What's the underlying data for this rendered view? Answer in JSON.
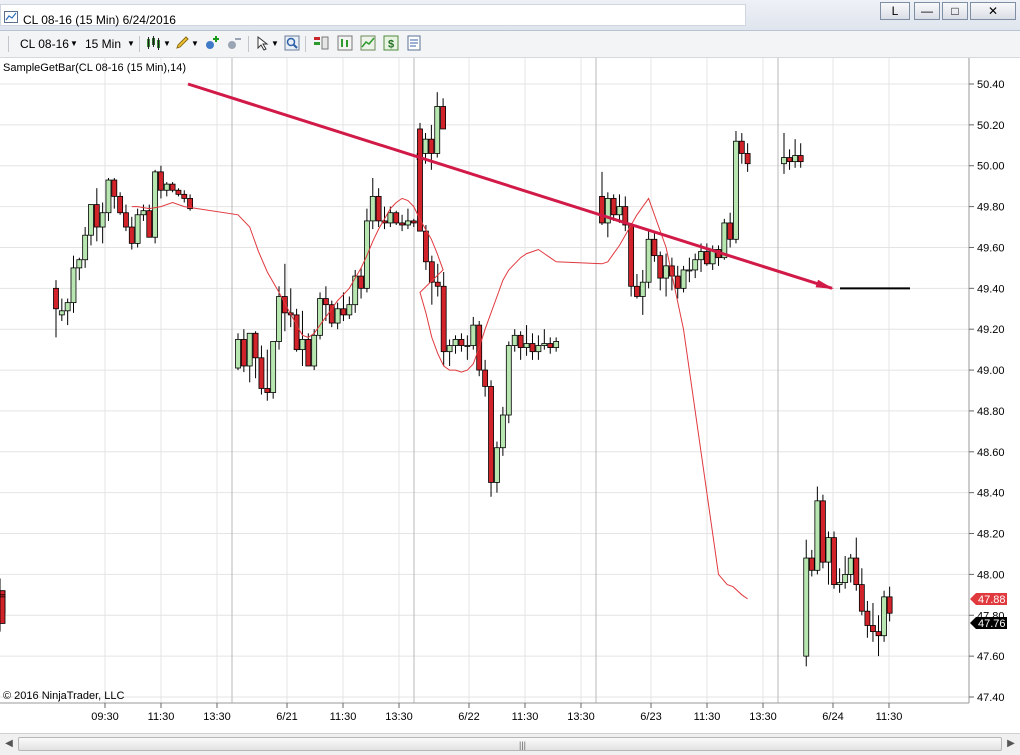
{
  "window": {
    "title": "CL 08-16 (15 Min)  6/24/2016",
    "layout_button": "L",
    "minimize_label": "—",
    "maximize_label": "□",
    "close_label": "✕"
  },
  "toolbar": {
    "instrument": "CL 08-16",
    "interval": "15 Min"
  },
  "chart": {
    "indicator_label": "SampleGetBar(CL 08-16 (15 Min),14)",
    "copyright": "© 2016 NinjaTrader, LLC",
    "last_price_label": "47.76",
    "indicator_price_label": "47.88",
    "colors": {
      "up": "#b8e6b0",
      "down": "#d2232a",
      "wick": "#000000",
      "sma": "#e0393e",
      "arrow": "#d11a47",
      "grid": "#e4e4e4",
      "session": "#b8b8b8"
    }
  },
  "chart_data": {
    "type": "candlestick",
    "title": "",
    "ylim": [
      47.4,
      50.5
    ],
    "y_ticks": [
      "50.40",
      "50.20",
      "50.00",
      "49.80",
      "49.60",
      "49.40",
      "49.20",
      "49.00",
      "48.80",
      "48.60",
      "48.40",
      "48.20",
      "48.00",
      "47.80",
      "47.60",
      "47.40"
    ],
    "x_ticks": [
      "09:30",
      "11:30",
      "13:30",
      "6/21",
      "11:30",
      "13:30",
      "6/22",
      "11:30",
      "13:30",
      "6/23",
      "11:30",
      "13:30",
      "6/24",
      "11:30"
    ],
    "session_separators": [
      "6/20",
      "6/21",
      "6/22",
      "6/23",
      "6/24"
    ],
    "candles": [
      [
        49.4,
        49.44,
        49.16,
        49.3
      ],
      [
        49.27,
        49.35,
        49.24,
        49.29
      ],
      [
        49.29,
        49.35,
        49.22,
        49.33
      ],
      [
        49.33,
        49.56,
        49.28,
        49.5
      ],
      [
        49.5,
        49.55,
        49.44,
        49.54
      ],
      [
        49.54,
        49.7,
        49.5,
        49.66
      ],
      [
        49.66,
        49.81,
        49.61,
        49.81
      ],
      [
        49.81,
        49.89,
        49.63,
        49.7
      ],
      [
        49.7,
        49.82,
        49.62,
        49.77
      ],
      [
        49.77,
        49.94,
        49.73,
        49.93
      ],
      [
        49.93,
        49.94,
        49.79,
        49.85
      ],
      [
        49.85,
        49.87,
        49.76,
        49.77
      ],
      [
        49.77,
        49.81,
        49.68,
        49.7
      ],
      [
        49.7,
        49.75,
        49.59,
        49.62
      ],
      [
        49.62,
        49.79,
        49.6,
        49.76
      ],
      [
        49.76,
        49.81,
        49.73,
        49.78
      ],
      [
        49.78,
        49.81,
        49.65,
        49.65
      ],
      [
        49.65,
        49.98,
        49.62,
        49.97
      ],
      [
        49.97,
        50.0,
        49.84,
        49.88
      ],
      [
        49.88,
        49.92,
        49.85,
        49.91
      ],
      [
        49.91,
        49.92,
        49.87,
        49.88
      ],
      [
        49.88,
        49.89,
        49.85,
        49.86
      ],
      [
        49.86,
        49.88,
        49.82,
        49.84
      ],
      [
        49.84,
        49.86,
        49.78,
        49.79
      ],
      [
        49.01,
        49.18,
        49.0,
        49.15
      ],
      [
        49.15,
        49.2,
        48.99,
        49.02
      ],
      [
        49.02,
        49.15,
        48.94,
        49.18
      ],
      [
        49.18,
        49.19,
        48.96,
        49.06
      ],
      [
        49.06,
        49.12,
        48.88,
        48.91
      ],
      [
        48.91,
        49.1,
        48.85,
        48.89
      ],
      [
        48.89,
        49.14,
        48.86,
        49.14
      ],
      [
        49.14,
        49.41,
        49.1,
        49.36
      ],
      [
        49.36,
        49.52,
        49.19,
        49.28
      ],
      [
        49.28,
        49.4,
        49.21,
        49.27
      ],
      [
        49.27,
        49.3,
        49.09,
        49.1
      ],
      [
        49.1,
        49.29,
        49.02,
        49.15
      ],
      [
        49.15,
        49.18,
        49.03,
        49.02
      ],
      [
        49.02,
        49.2,
        49.0,
        49.17
      ],
      [
        49.17,
        49.38,
        49.15,
        49.35
      ],
      [
        49.35,
        49.41,
        49.24,
        49.32
      ],
      [
        49.32,
        49.34,
        49.21,
        49.23
      ],
      [
        49.23,
        49.33,
        49.2,
        49.3
      ],
      [
        49.3,
        49.38,
        49.24,
        49.27
      ],
      [
        49.27,
        49.36,
        49.25,
        49.32
      ],
      [
        49.32,
        49.49,
        49.28,
        49.46
      ],
      [
        49.46,
        49.5,
        49.35,
        49.4
      ],
      [
        49.4,
        49.79,
        49.38,
        49.73
      ],
      [
        49.73,
        49.94,
        49.69,
        49.85
      ],
      [
        49.85,
        49.89,
        49.7,
        49.73
      ],
      [
        49.73,
        49.8,
        49.69,
        49.72
      ],
      [
        49.72,
        49.8,
        49.7,
        49.77
      ],
      [
        49.77,
        49.78,
        49.71,
        49.72
      ],
      [
        49.72,
        49.76,
        49.68,
        49.71
      ],
      [
        49.71,
        49.79,
        49.69,
        49.73
      ],
      [
        49.73,
        49.74,
        49.7,
        49.72
      ],
      [
        50.03,
        50.12,
        49.97,
        50.06
      ],
      [
        50.06,
        50.16,
        50.01,
        50.13
      ],
      [
        50.13,
        50.2,
        49.98,
        50.06
      ],
      [
        50.06,
        50.36,
        50.04,
        50.29
      ],
      [
        50.29,
        50.33,
        50.18,
        50.18
      ],
      [
        50.18,
        50.21,
        49.68,
        49.68
      ],
      [
        49.68,
        49.71,
        49.49,
        49.53
      ],
      [
        49.53,
        49.56,
        49.32,
        49.43
      ],
      [
        49.43,
        49.52,
        49.36,
        49.41
      ],
      [
        49.41,
        49.48,
        49.02,
        49.09
      ],
      [
        49.09,
        49.15,
        49.02,
        49.12
      ],
      [
        49.12,
        49.17,
        49.08,
        49.15
      ],
      [
        49.15,
        49.18,
        49.09,
        49.12
      ],
      [
        49.12,
        49.17,
        49.05,
        49.12
      ],
      [
        49.12,
        49.26,
        49.1,
        49.22
      ],
      [
        49.22,
        49.24,
        48.97,
        49.0
      ],
      [
        49.0,
        49.05,
        48.87,
        48.92
      ],
      [
        48.92,
        48.95,
        48.38,
        48.45
      ],
      [
        48.45,
        48.65,
        48.4,
        48.62
      ],
      [
        48.62,
        48.82,
        48.58,
        48.78
      ],
      [
        48.78,
        49.14,
        48.74,
        49.12
      ],
      [
        49.12,
        49.2,
        49.09,
        49.17
      ],
      [
        49.17,
        49.19,
        49.05,
        49.11
      ],
      [
        49.11,
        49.22,
        49.07,
        49.13
      ],
      [
        49.13,
        49.18,
        49.05,
        49.09
      ],
      [
        49.09,
        49.17,
        49.05,
        49.12
      ],
      [
        49.12,
        49.2,
        49.1,
        49.13
      ],
      [
        49.13,
        49.16,
        49.08,
        49.11
      ],
      [
        49.11,
        49.16,
        49.09,
        49.14
      ],
      [
        49.85,
        49.97,
        49.71,
        49.72
      ],
      [
        49.72,
        49.87,
        49.65,
        49.84
      ],
      [
        49.84,
        49.86,
        49.73,
        49.76
      ],
      [
        49.76,
        49.86,
        49.72,
        49.8
      ],
      [
        49.8,
        49.85,
        49.68,
        49.71
      ],
      [
        49.71,
        49.72,
        49.36,
        49.41
      ],
      [
        49.41,
        49.47,
        49.35,
        49.36
      ],
      [
        49.36,
        49.49,
        49.27,
        49.43
      ],
      [
        49.43,
        49.69,
        49.4,
        49.64
      ],
      [
        49.64,
        49.67,
        49.53,
        49.56
      ],
      [
        49.56,
        49.58,
        49.39,
        49.45
      ],
      [
        49.45,
        49.57,
        49.36,
        49.51
      ],
      [
        49.51,
        49.55,
        49.39,
        49.46
      ],
      [
        49.46,
        49.51,
        49.35,
        49.4
      ],
      [
        49.4,
        49.51,
        49.38,
        49.49
      ],
      [
        49.49,
        49.55,
        49.43,
        49.49
      ],
      [
        49.49,
        49.57,
        49.45,
        49.54
      ],
      [
        49.54,
        49.62,
        49.48,
        49.58
      ],
      [
        49.58,
        49.62,
        49.51,
        49.52
      ],
      [
        49.52,
        49.61,
        49.49,
        49.59
      ],
      [
        49.59,
        49.61,
        49.51,
        49.55
      ],
      [
        49.55,
        49.74,
        49.54,
        49.72
      ],
      [
        49.72,
        49.77,
        49.6,
        49.64
      ],
      [
        49.64,
        50.17,
        49.62,
        50.12
      ],
      [
        50.12,
        50.16,
        50.01,
        50.06
      ],
      [
        50.06,
        50.11,
        49.97,
        50.01
      ],
      [
        50.01,
        50.16,
        49.96,
        50.04
      ],
      [
        50.04,
        50.08,
        49.98,
        50.02
      ],
      [
        50.02,
        50.13,
        49.99,
        50.05
      ],
      [
        50.05,
        50.11,
        49.99,
        50.02
      ],
      [
        47.6,
        48.17,
        47.55,
        48.08
      ],
      [
        48.08,
        48.12,
        47.99,
        48.02
      ],
      [
        48.02,
        48.43,
        48.0,
        48.36
      ],
      [
        48.36,
        48.39,
        48.03,
        48.06
      ],
      [
        48.06,
        48.21,
        47.95,
        48.18
      ],
      [
        48.18,
        48.21,
        47.93,
        47.95
      ],
      [
        47.95,
        48.03,
        47.91,
        47.96
      ],
      [
        47.96,
        48.09,
        47.93,
        48.0
      ],
      [
        48.0,
        48.1,
        47.96,
        48.08
      ],
      [
        48.08,
        48.18,
        47.92,
        47.95
      ],
      [
        47.95,
        48.03,
        47.8,
        47.82
      ],
      [
        47.82,
        47.87,
        47.69,
        47.75
      ],
      [
        47.75,
        47.86,
        47.67,
        47.72
      ],
      [
        47.72,
        47.8,
        47.6,
        47.7
      ],
      [
        47.7,
        47.92,
        47.67,
        47.89
      ],
      [
        47.89,
        47.94,
        47.77,
        47.81
      ],
      [
        47.81,
        47.98,
        47.78,
        47.92
      ],
      [
        47.92,
        47.96,
        47.86,
        47.9
      ],
      [
        47.9,
        47.94,
        47.84,
        47.89
      ],
      [
        47.89,
        47.91,
        47.72,
        47.76
      ]
    ],
    "sma": [
      [
        13,
        49.8
      ],
      [
        14,
        49.8
      ],
      [
        16,
        49.79
      ],
      [
        18,
        49.8
      ],
      [
        20,
        49.82
      ],
      [
        22,
        49.8
      ],
      [
        24,
        49.76
      ],
      [
        26,
        49.7
      ],
      [
        27.5,
        49.58
      ],
      [
        29,
        49.48
      ],
      [
        31,
        49.38
      ],
      [
        32.5,
        49.3
      ],
      [
        34,
        49.22
      ],
      [
        35,
        49.17
      ],
      [
        36,
        49.16
      ],
      [
        37,
        49.18
      ],
      [
        38,
        49.22
      ],
      [
        39,
        49.26
      ],
      [
        40,
        49.3
      ],
      [
        41,
        49.34
      ],
      [
        42,
        49.37
      ],
      [
        43,
        49.4
      ],
      [
        44,
        49.45
      ],
      [
        45,
        49.5
      ],
      [
        46,
        49.56
      ],
      [
        47,
        49.63
      ],
      [
        48,
        49.69
      ],
      [
        49,
        49.74
      ],
      [
        50,
        49.79
      ],
      [
        51,
        49.82
      ],
      [
        52,
        49.84
      ],
      [
        53,
        49.83
      ],
      [
        54,
        49.8
      ],
      [
        55,
        49.74
      ],
      [
        56,
        49.69
      ],
      [
        57,
        49.64
      ],
      [
        58,
        49.57
      ],
      [
        59,
        49.49
      ],
      [
        60,
        49.38
      ],
      [
        61,
        49.28
      ],
      [
        62,
        49.16
      ],
      [
        63,
        49.08
      ],
      [
        64,
        49.02
      ],
      [
        65,
        49.0
      ],
      [
        66,
        49.0
      ],
      [
        67,
        48.99
      ],
      [
        68,
        49.0
      ],
      [
        69,
        49.03
      ],
      [
        70,
        49.11
      ],
      [
        71,
        49.2
      ],
      [
        72,
        49.28
      ],
      [
        73,
        49.36
      ],
      [
        74,
        49.44
      ],
      [
        75,
        49.49
      ],
      [
        76,
        49.52
      ],
      [
        77,
        49.55
      ],
      [
        78,
        49.57
      ],
      [
        79,
        49.58
      ],
      [
        80,
        49.59
      ],
      [
        81,
        49.57
      ],
      [
        82,
        49.55
      ],
      [
        83,
        49.53
      ],
      [
        84,
        49.52
      ],
      [
        85,
        49.53
      ],
      [
        86,
        49.57
      ],
      [
        87,
        49.61
      ],
      [
        88,
        49.66
      ],
      [
        89,
        49.71
      ],
      [
        90,
        49.76
      ],
      [
        91,
        49.8
      ],
      [
        92,
        49.84
      ],
      [
        95,
        49.6
      ],
      [
        98,
        49.2
      ],
      [
        101,
        48.6
      ],
      [
        104,
        48.0
      ],
      [
        105.5,
        47.95
      ],
      [
        106.5,
        47.94
      ],
      [
        108,
        47.9
      ],
      [
        109,
        47.88
      ]
    ],
    "annotations": [
      {
        "type": "arrow",
        "from": [
          23,
          50.4
        ],
        "to": [
          104,
          49.4
        ]
      },
      {
        "type": "hline",
        "from": [
          105,
          49.4
        ],
        "to": [
          114,
          49.4
        ]
      }
    ]
  }
}
